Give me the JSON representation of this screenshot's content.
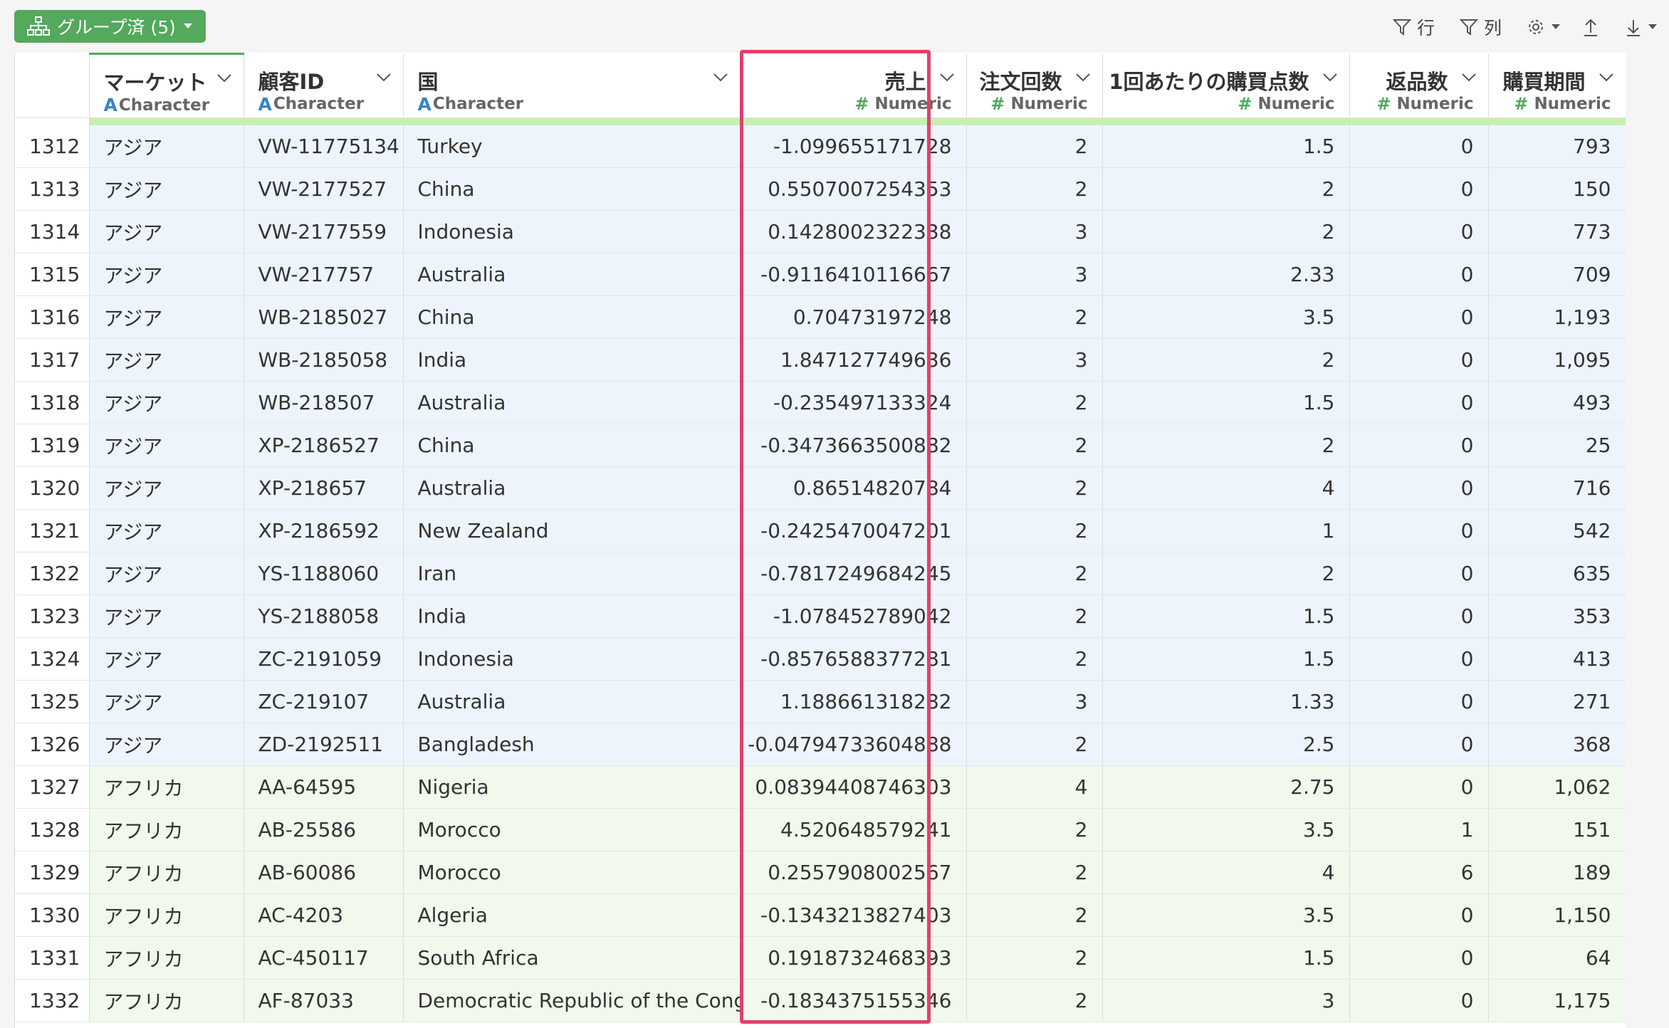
{
  "toolbar": {
    "group_label": "グループ済 (5)",
    "filter_row_label": "行",
    "filter_col_label": "列",
    "icons": [
      "hierarchy-icon",
      "filter-icon",
      "filter-icon",
      "gear-icon",
      "upload-icon",
      "download-icon"
    ]
  },
  "columns": [
    {
      "name": "マーケット",
      "type": "Character"
    },
    {
      "name": "顧客ID",
      "type": "Character"
    },
    {
      "name": "国",
      "type": "Character"
    },
    {
      "name": "売上",
      "type": "Numeric"
    },
    {
      "name": "注文回数",
      "type": "Numeric"
    },
    {
      "name": "1回あたりの購買点数",
      "type": "Numeric"
    },
    {
      "name": "返品数",
      "type": "Numeric"
    },
    {
      "name": "購買期間",
      "type": "Numeric"
    }
  ],
  "highlighted_column": "売上",
  "rows": [
    {
      "n": "1312",
      "market": "アジア",
      "id": "VW-11775134",
      "country": "Turkey",
      "sales": "-1.099655171728",
      "orders": "2",
      "items": "1.5",
      "returns": "0",
      "period": "793"
    },
    {
      "n": "1313",
      "market": "アジア",
      "id": "VW-2177527",
      "country": "China",
      "sales": "0.5507007254353",
      "orders": "2",
      "items": "2",
      "returns": "0",
      "period": "150"
    },
    {
      "n": "1314",
      "market": "アジア",
      "id": "VW-2177559",
      "country": "Indonesia",
      "sales": "0.1428002322338",
      "orders": "3",
      "items": "2",
      "returns": "0",
      "period": "773"
    },
    {
      "n": "1315",
      "market": "アジア",
      "id": "VW-217757",
      "country": "Australia",
      "sales": "-0.9116410116667",
      "orders": "3",
      "items": "2.33",
      "returns": "0",
      "period": "709"
    },
    {
      "n": "1316",
      "market": "アジア",
      "id": "WB-2185027",
      "country": "China",
      "sales": "0.70473197248",
      "orders": "2",
      "items": "3.5",
      "returns": "0",
      "period": "1,193"
    },
    {
      "n": "1317",
      "market": "アジア",
      "id": "WB-2185058",
      "country": "India",
      "sales": "1.847127749636",
      "orders": "3",
      "items": "2",
      "returns": "0",
      "period": "1,095"
    },
    {
      "n": "1318",
      "market": "アジア",
      "id": "WB-218507",
      "country": "Australia",
      "sales": "-0.235497133324",
      "orders": "2",
      "items": "1.5",
      "returns": "0",
      "period": "493"
    },
    {
      "n": "1319",
      "market": "アジア",
      "id": "XP-2186527",
      "country": "China",
      "sales": "-0.3473663500882",
      "orders": "2",
      "items": "2",
      "returns": "0",
      "period": "25"
    },
    {
      "n": "1320",
      "market": "アジア",
      "id": "XP-218657",
      "country": "Australia",
      "sales": "0.86514820784",
      "orders": "2",
      "items": "4",
      "returns": "0",
      "period": "716"
    },
    {
      "n": "1321",
      "market": "アジア",
      "id": "XP-2186592",
      "country": "New Zealand",
      "sales": "-0.2425470047201",
      "orders": "2",
      "items": "1",
      "returns": "0",
      "period": "542"
    },
    {
      "n": "1322",
      "market": "アジア",
      "id": "YS-1188060",
      "country": "Iran",
      "sales": "-0.7817249684245",
      "orders": "2",
      "items": "2",
      "returns": "0",
      "period": "635"
    },
    {
      "n": "1323",
      "market": "アジア",
      "id": "YS-2188058",
      "country": "India",
      "sales": "-1.078452789042",
      "orders": "2",
      "items": "1.5",
      "returns": "0",
      "period": "353"
    },
    {
      "n": "1324",
      "market": "アジア",
      "id": "ZC-2191059",
      "country": "Indonesia",
      "sales": "-0.8576588377281",
      "orders": "2",
      "items": "1.5",
      "returns": "0",
      "period": "413"
    },
    {
      "n": "1325",
      "market": "アジア",
      "id": "ZC-219107",
      "country": "Australia",
      "sales": "1.188661318282",
      "orders": "3",
      "items": "1.33",
      "returns": "0",
      "period": "271"
    },
    {
      "n": "1326",
      "market": "アジア",
      "id": "ZD-2192511",
      "country": "Bangladesh",
      "sales": "-0.04794733604888",
      "orders": "2",
      "items": "2.5",
      "returns": "0",
      "period": "368"
    },
    {
      "n": "1327",
      "market": "アフリカ",
      "id": "AA-64595",
      "country": "Nigeria",
      "sales": "0.08394408746303",
      "orders": "4",
      "items": "2.75",
      "returns": "0",
      "period": "1,062"
    },
    {
      "n": "1328",
      "market": "アフリカ",
      "id": "AB-25586",
      "country": "Morocco",
      "sales": "4.520648579241",
      "orders": "2",
      "items": "3.5",
      "returns": "1",
      "period": "151"
    },
    {
      "n": "1329",
      "market": "アフリカ",
      "id": "AB-60086",
      "country": "Morocco",
      "sales": "0.2557908002567",
      "orders": "2",
      "items": "4",
      "returns": "6",
      "period": "189"
    },
    {
      "n": "1330",
      "market": "アフリカ",
      "id": "AC-4203",
      "country": "Algeria",
      "sales": "-0.1343213827403",
      "orders": "2",
      "items": "3.5",
      "returns": "0",
      "period": "1,150"
    },
    {
      "n": "1331",
      "market": "アフリカ",
      "id": "AC-450117",
      "country": "South Africa",
      "sales": "0.1918732468393",
      "orders": "2",
      "items": "1.5",
      "returns": "0",
      "period": "64"
    },
    {
      "n": "1332",
      "market": "アフリカ",
      "id": "AF-87033",
      "country": "Democratic Republic of the Congo",
      "sales": "-0.1834375155346",
      "orders": "2",
      "items": "3",
      "returns": "0",
      "period": "1,175"
    }
  ]
}
